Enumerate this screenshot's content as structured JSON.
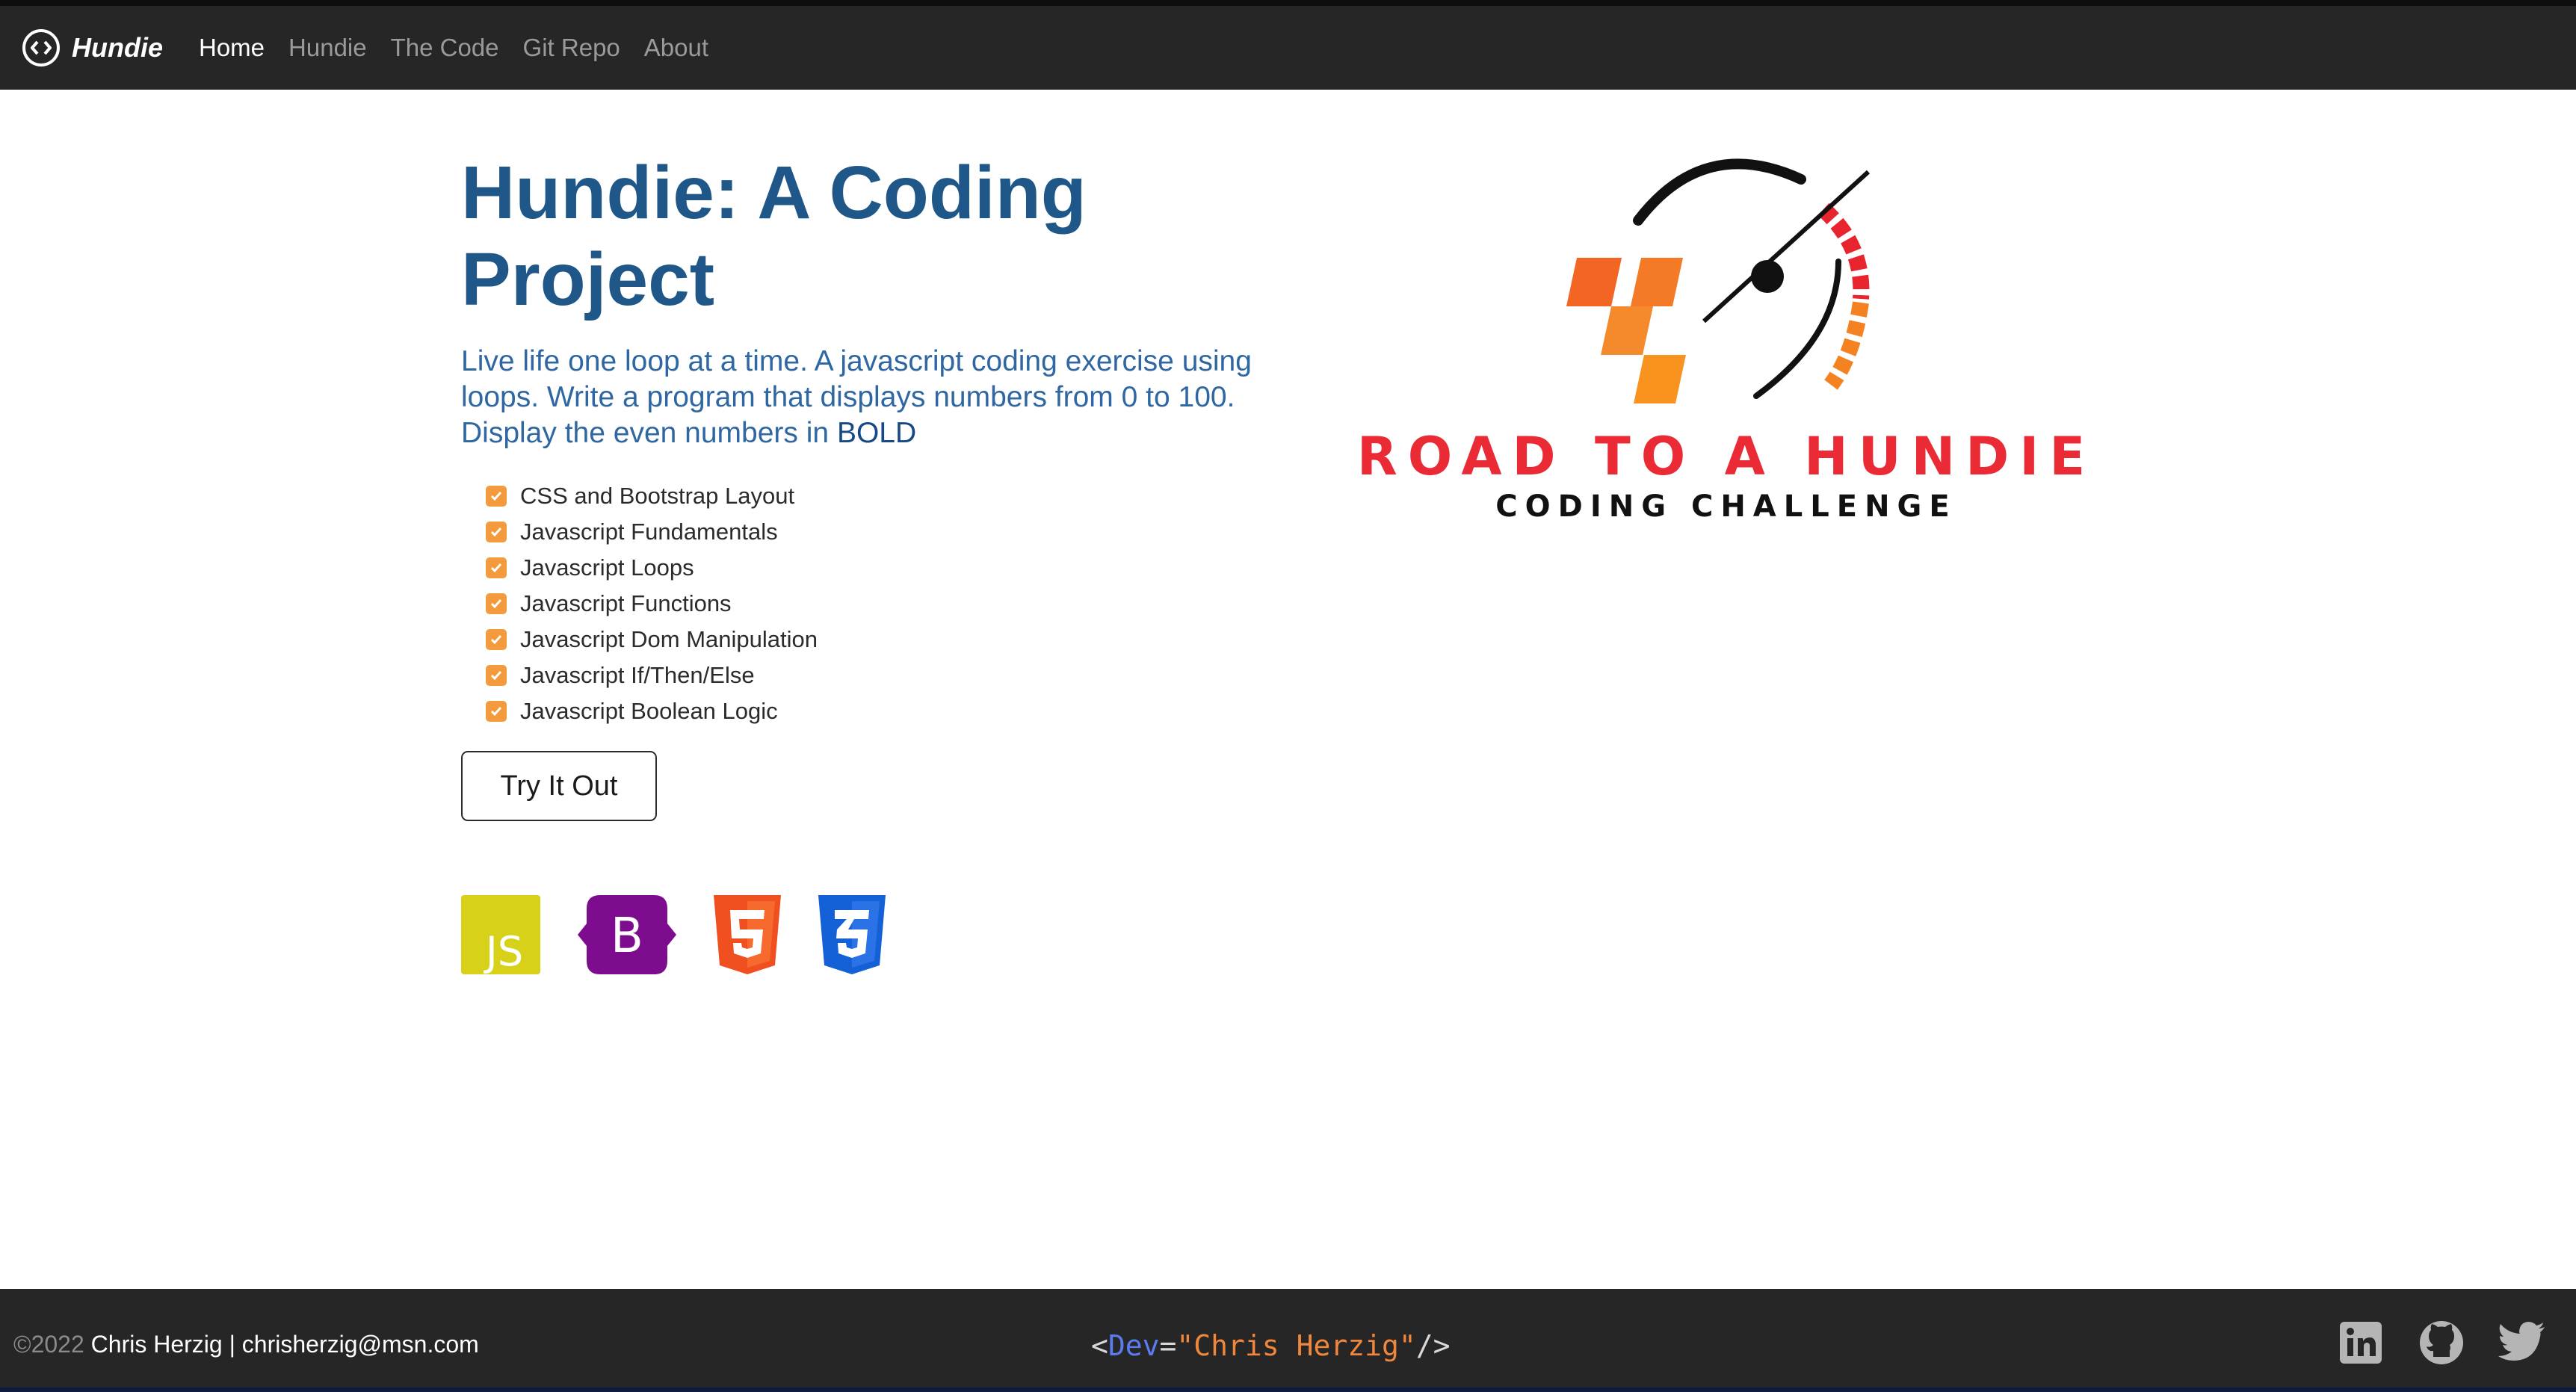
{
  "nav": {
    "brand": "Hundie",
    "links": [
      {
        "label": "Home",
        "active": true
      },
      {
        "label": "Hundie",
        "active": false
      },
      {
        "label": "The Code",
        "active": false
      },
      {
        "label": "Git Repo",
        "active": false
      },
      {
        "label": "About",
        "active": false
      }
    ]
  },
  "hero": {
    "title_line1": "Hundie: A Coding",
    "title_line2": "Project",
    "lead": "Live life one loop at a time. A javascript coding exercise using loops. Write a program that displays numbers from 0 to 100. Display the even numbers in",
    "lead_bold": "BOLD",
    "checklist": [
      "CSS and Bootstrap Layout",
      "Javascript Fundamentals",
      "Javascript Loops",
      "Javascript Functions",
      "Javascript Dom Manipulation",
      "Javascript If/Then/Else",
      "Javascript Boolean Logic"
    ],
    "button": "Try It Out",
    "tech_icons": [
      "javascript-icon",
      "bootstrap-icon",
      "html5-icon",
      "css3-icon"
    ]
  },
  "logo": {
    "title": "ROAD TO A HUNDIE",
    "subtitle": "CODING CHALLENGE"
  },
  "footer": {
    "year": "©2022",
    "owner": " Chris Herzig | chrisherzig@msn.com",
    "dev_open": "<",
    "dev_tag": "Dev",
    "dev_eq": "=",
    "dev_value": "\"Chris Herzig\"",
    "dev_close": "/>",
    "socials": [
      "linkedin-icon",
      "github-icon",
      "twitter-icon"
    ]
  },
  "colors": {
    "navbar": "#262626",
    "title": "#1f5888",
    "lead": "#2f67a3",
    "check": "#f39a3c",
    "logo_red": "#ea2b36",
    "logo_orange": "#f7931e"
  }
}
